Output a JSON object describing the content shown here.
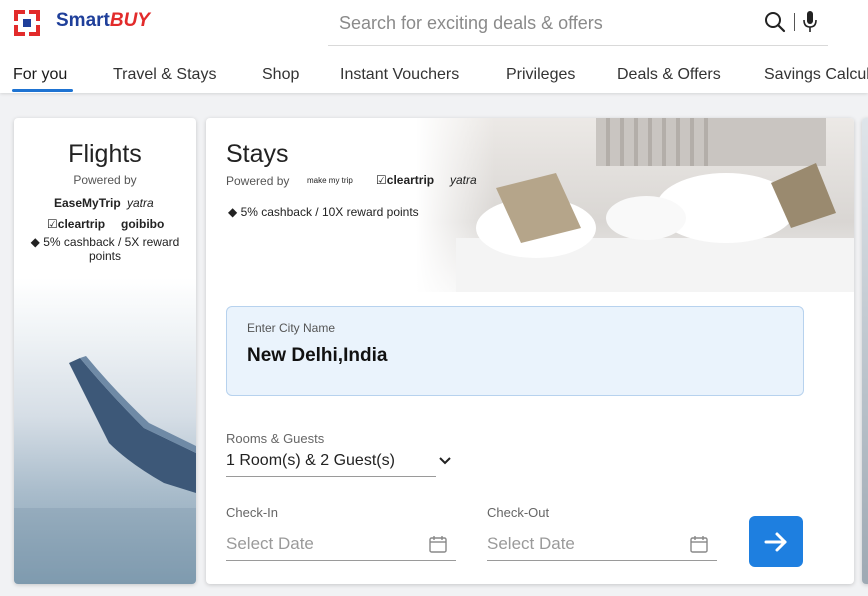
{
  "header": {
    "logo_smart": "Smart",
    "logo_buy": "BUY",
    "search_placeholder": "Search for exciting deals & offers"
  },
  "nav": {
    "items": [
      {
        "label": "For you",
        "active": true
      },
      {
        "label": "Travel & Stays"
      },
      {
        "label": "Shop"
      },
      {
        "label": "Instant Vouchers"
      },
      {
        "label": "Privileges"
      },
      {
        "label": "Deals & Offers"
      },
      {
        "label": "Savings Calcul"
      }
    ]
  },
  "flights": {
    "title": "Flights",
    "powered_by": "Powered by",
    "partners": [
      "EaseMyTrip",
      "yatra",
      "cleartrip",
      "goibibo"
    ],
    "cashback": "5% cashback / 5X reward points"
  },
  "stays": {
    "title": "Stays",
    "powered_by": "Powered by",
    "partners": [
      "make my trip",
      "cleartrip",
      "yatra"
    ],
    "cashback": "5% cashback / 10X reward points",
    "city_label": "Enter City Name",
    "city_value": "New Delhi,India",
    "rooms_label": "Rooms & Guests",
    "rooms_value": "1 Room(s) &  2 Guest(s)",
    "checkin_label": "Check-In",
    "checkin_value": "Select Date",
    "checkout_label": "Check-Out",
    "checkout_value": "Select Date"
  },
  "colors": {
    "brand_blue": "#1f3f9a",
    "brand_red": "#e22b2b",
    "accent": "#1e7fe0",
    "city_box_bg": "#eaf3fc"
  }
}
